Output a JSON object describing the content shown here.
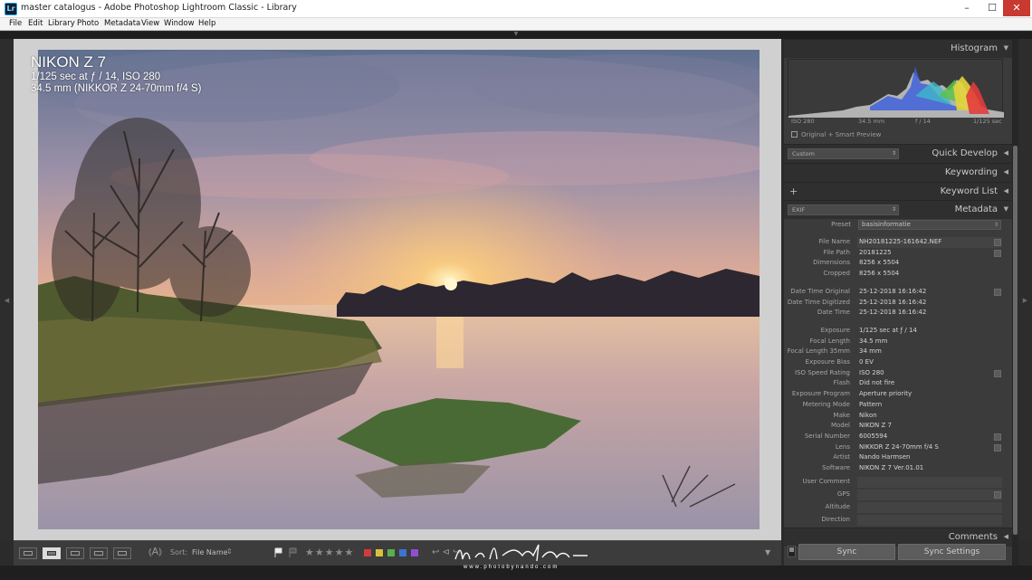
{
  "window": {
    "title": "master catalogus - Adobe Photoshop Lightroom Classic - Library",
    "app_icon": "Lr",
    "controls": {
      "minimize": "–",
      "maximize": "☐",
      "close": "✕"
    }
  },
  "menu": [
    "File",
    "Edit",
    "Library",
    "Photo",
    "Metadata",
    "View",
    "Window",
    "Help"
  ],
  "photo_info": {
    "camera": "NIKON Z 7",
    "exposure_line": "1/125 sec at ƒ / 14, ISO 280",
    "lens_line": "34.5 mm (NIKKOR Z 24-70mm f/4 S)"
  },
  "toolbar": {
    "sort_label": "Sort:",
    "sort_value": "File Name",
    "sort_arrows": "⇕",
    "stars": "★★★★★",
    "color_labels": [
      "#d23b3b",
      "#d8c13a",
      "#58b04a",
      "#3c74d6",
      "#8e4fd1"
    ],
    "more_icons": "↩ ⊲ ↪",
    "menu_arrow": "▼"
  },
  "watermark": {
    "url": "www.photobynando.com"
  },
  "right_panel": {
    "histogram": {
      "title": "Histogram",
      "iso": "ISO 280",
      "focal": "34.5 mm",
      "aperture": "f / 14",
      "shutter": "1/125 sec",
      "preview": "Original + Smart Preview"
    },
    "quick_develop": {
      "title": "Quick Develop",
      "select": "Custom"
    },
    "keywording": {
      "title": "Keywording"
    },
    "keyword_list": {
      "title": "Keyword List",
      "plus": "+"
    },
    "metadata": {
      "title": "Metadata",
      "select": "EXIF",
      "preset_label": "Preset",
      "preset_value": "basisinformatie",
      "rows": [
        {
          "k": "File Name",
          "v": "NH20181225-161642.NEF"
        },
        {
          "k": "File Path",
          "v": "20181225"
        },
        {
          "k": "Dimensions",
          "v": "8256 x 5504"
        },
        {
          "k": "Cropped",
          "v": "8256 x 5504"
        },
        {
          "k": "Date Time Original",
          "v": "25-12-2018 16:16:42"
        },
        {
          "k": "Date Time Digitized",
          "v": "25-12-2018 16:16:42"
        },
        {
          "k": "Date Time",
          "v": "25-12-2018 16:16:42"
        },
        {
          "k": "Exposure",
          "v": "1/125 sec at ƒ / 14"
        },
        {
          "k": "Focal Length",
          "v": "34.5 mm"
        },
        {
          "k": "Focal Length 35mm",
          "v": "34 mm"
        },
        {
          "k": "Exposure Bias",
          "v": "0 EV"
        },
        {
          "k": "ISO Speed Rating",
          "v": "ISO 280"
        },
        {
          "k": "Flash",
          "v": "Did not fire"
        },
        {
          "k": "Exposure Program",
          "v": "Aperture priority"
        },
        {
          "k": "Metering Mode",
          "v": "Pattern"
        },
        {
          "k": "Make",
          "v": "Nikon"
        },
        {
          "k": "Model",
          "v": "NIKON Z 7"
        },
        {
          "k": "Serial Number",
          "v": "6005594"
        },
        {
          "k": "Lens",
          "v": "NIKKOR Z 24-70mm f/4 S"
        },
        {
          "k": "Artist",
          "v": "Nando Harmsen"
        },
        {
          "k": "Software",
          "v": "NIKON Z 7 Ver.01.01"
        },
        {
          "k": "User Comment",
          "v": ""
        },
        {
          "k": "GPS",
          "v": ""
        },
        {
          "k": "Altitude",
          "v": ""
        },
        {
          "k": "Direction",
          "v": ""
        }
      ]
    },
    "comments": {
      "title": "Comments"
    },
    "sync": {
      "sync": "Sync",
      "sync_settings": "Sync Settings"
    }
  }
}
